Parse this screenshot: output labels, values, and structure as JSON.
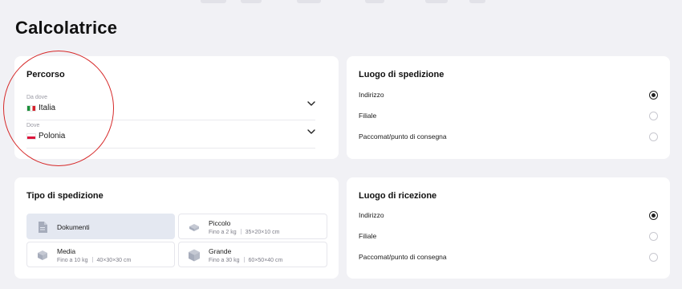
{
  "page": {
    "title": "Calcolatrice"
  },
  "route": {
    "title": "Percorso",
    "from": {
      "label": "Da dove",
      "value": "Italia",
      "flag": "italy-flag-icon"
    },
    "to": {
      "label": "Dove",
      "value": "Polonia",
      "flag": "poland-flag-icon"
    }
  },
  "shipping_place": {
    "title": "Luogo di spedizione",
    "options": [
      {
        "label": "Indirizzo",
        "selected": true
      },
      {
        "label": "Filiale",
        "selected": false
      },
      {
        "label": "Paccomat/punto di consegna",
        "selected": false
      }
    ]
  },
  "shipment_type": {
    "title": "Tipo di spedizione",
    "options": [
      {
        "name": "Dokumenti",
        "weight": "",
        "size": "",
        "icon": "document-icon",
        "selected": true
      },
      {
        "name": "Piccolo",
        "weight": "Fino a 2 kg",
        "size": "35×20×10 cm",
        "icon": "small-package-icon",
        "selected": false
      },
      {
        "name": "Media",
        "weight": "Fino a 10 kg",
        "size": "40×30×30 cm",
        "icon": "medium-package-icon",
        "selected": false
      },
      {
        "name": "Grande",
        "weight": "Fino a 30 kg",
        "size": "60×50×40 cm",
        "icon": "large-package-icon",
        "selected": false
      }
    ]
  },
  "receiving_place": {
    "title": "Luogo di ricezione",
    "options": [
      {
        "label": "Indirizzo",
        "selected": true
      },
      {
        "label": "Filiale",
        "selected": false
      },
      {
        "label": "Paccomat/punto di consegna",
        "selected": false
      }
    ]
  },
  "colors": {
    "background": "#f1f1f5",
    "card": "#ffffff",
    "selected_option": "#e4e8f1",
    "annotation": "#d62828"
  }
}
